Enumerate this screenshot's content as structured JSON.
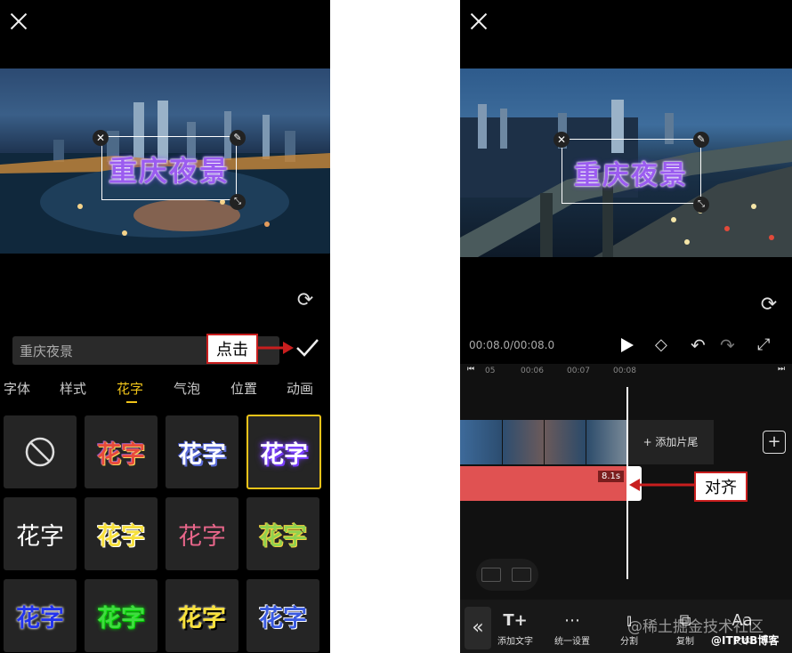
{
  "left": {
    "overlay_text": "重庆夜景",
    "input_value": "重庆夜景",
    "annotation": "点击",
    "tabs": [
      "字体",
      "样式",
      "花字",
      "气泡",
      "位置",
      "动画"
    ],
    "active_tab": "花字",
    "tiles": [
      {
        "text": "",
        "style": "none"
      },
      {
        "text": "花字",
        "style": "red-yellow"
      },
      {
        "text": "花字",
        "style": "white-blue"
      },
      {
        "text": "花字",
        "style": "purple-glow"
      },
      {
        "text": "花字",
        "style": "white"
      },
      {
        "text": "花字",
        "style": "yellow"
      },
      {
        "text": "花字",
        "style": "pink"
      },
      {
        "text": "花字",
        "style": "green-yellow"
      },
      {
        "text": "花字",
        "style": "blue"
      },
      {
        "text": "花字",
        "style": "green"
      },
      {
        "text": "花字",
        "style": "yellow-black"
      },
      {
        "text": "花字",
        "style": "blue-white"
      }
    ]
  },
  "right": {
    "overlay_text": "重庆夜景",
    "time_display": "00:08.0/00:08.0",
    "ruler_ticks": [
      "05",
      "00:06",
      "00:07",
      "00:08"
    ],
    "add_ending": "+ 添加片尾",
    "clip_duration": "8.1s",
    "annotation": "对齐",
    "toolbar": [
      {
        "icon": "text-add-icon",
        "label": "添加文字"
      },
      {
        "icon": "more-icon",
        "label": "统一设置"
      },
      {
        "icon": "split-icon",
        "label": "分割"
      },
      {
        "icon": "copy-icon",
        "label": "复制"
      },
      {
        "icon": "text-style-icon",
        "label": "文本"
      }
    ],
    "watermark": "@稀土掘金技术社区",
    "watermark2": "@ITPUB博客"
  },
  "colors": {
    "accent": "#f0c419",
    "clip_red": "#e05252",
    "annotation_red": "#c81e1e"
  }
}
